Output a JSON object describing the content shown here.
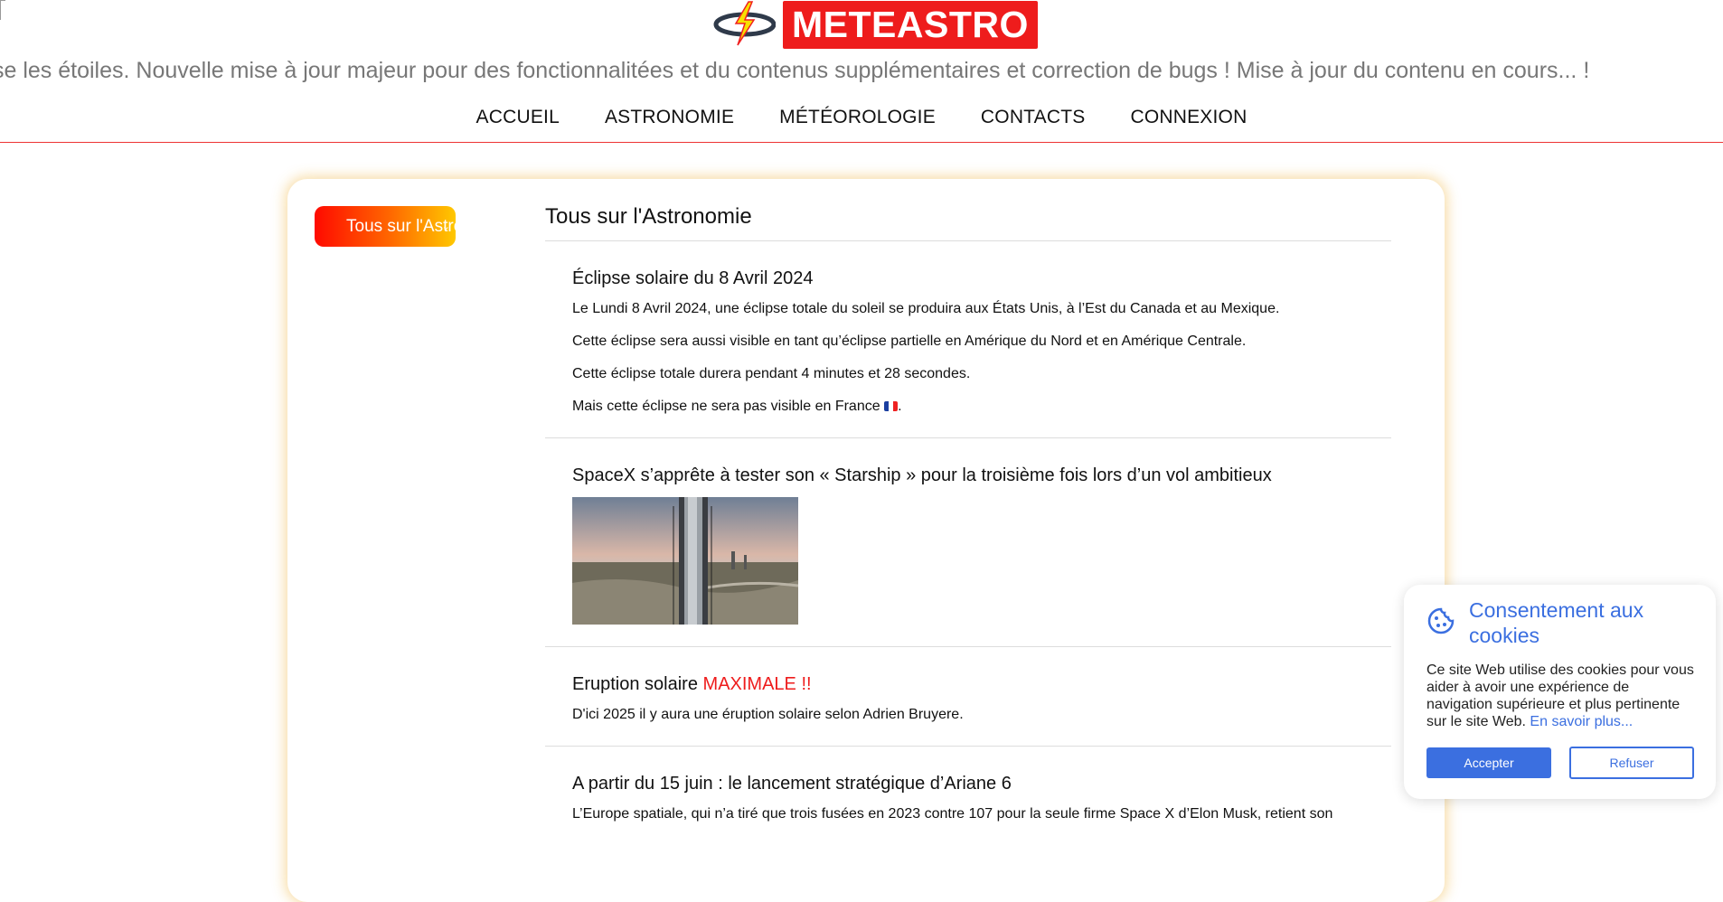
{
  "brand": {
    "name": "METEASTRO",
    "brand_color": "#ee1c1c"
  },
  "ticker": "se les étoiles. Nouvelle mise à jour majeur pour des fonctionnalitées et du contenus supplémentaires et correction de bugs ! Mise à jour du contenu en cours... !",
  "nav": {
    "items": [
      "ACCUEIL",
      "ASTRONOMIE",
      "MÉTÉOROLOGIE",
      "CONTACTS",
      "CONNEXION"
    ]
  },
  "filter": {
    "selected": "Tous sur l'Astronomie"
  },
  "content": {
    "heading": "Tous sur l'Astronomie",
    "articles": [
      {
        "title": "Éclipse solaire du 8 Avril 2024",
        "paragraphs": [
          "Le Lundi 8 Avril 2024, une éclipse totale du soleil se produira aux États Unis, à l’Est du Canada et au Mexique.",
          "Cette éclipse sera aussi visible en tant qu’éclipse partielle en Amérique du Nord et en Amérique Centrale.",
          "Cette éclipse totale durera pendant 4 minutes et 28 secondes.",
          "Mais cette éclipse ne sera pas visible en France"
        ],
        "suffix": "."
      },
      {
        "title": "SpaceX s’apprête à tester son « Starship » pour la troisième fois lors d’un vol ambitieux"
      },
      {
        "title_plain": "Eruption solaire ",
        "title_highlight": "MAXIMALE !!",
        "paragraph": "D'ici 2025 il y aura une éruption solaire selon Adrien Bruyere."
      },
      {
        "title": "A partir du 15 juin : le lancement stratégique d’Ariane 6",
        "paragraph": "L’Europe spatiale, qui n’a tiré que trois fusées en 2023 contre 107 pour la seule firme Space X d’Elon Musk, retient son"
      }
    ]
  },
  "cookie": {
    "title": "Consentement aux cookies",
    "text": "Ce site Web utilise des cookies pour vous aider à avoir une expérience de navigation supérieure et plus pertinente sur le site Web. ",
    "link": "En savoir plus...",
    "accept": "Accepter",
    "refuse": "Refuser",
    "accent_color": "#3b6fe0"
  }
}
